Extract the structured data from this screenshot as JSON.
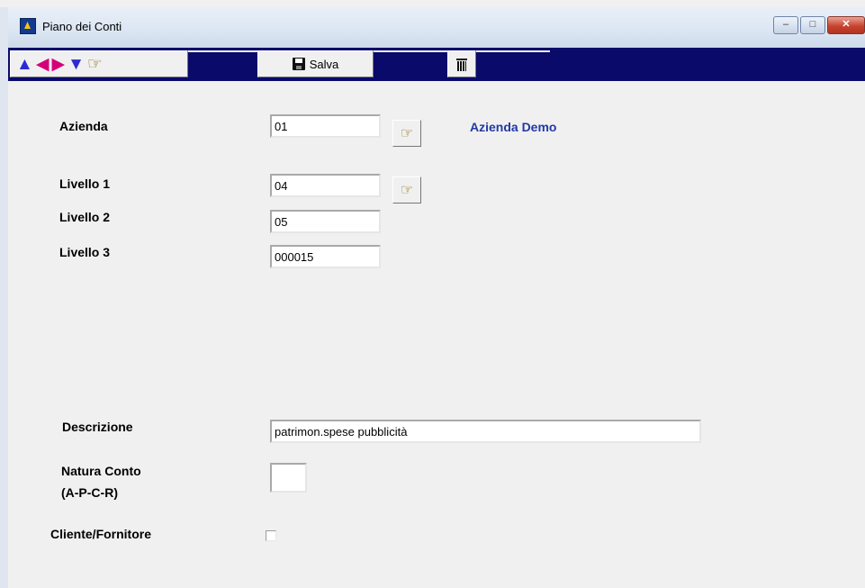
{
  "window": {
    "title": "Piano dei Conti",
    "controls": {
      "minimize": "–",
      "maximize": "□",
      "close": "✕"
    }
  },
  "toolbar": {
    "nav": [
      {
        "name": "first-record-icon",
        "glyph": "▲",
        "color": "#2b2bd6"
      },
      {
        "name": "previous-record-icon",
        "glyph": "◀",
        "color": "#d4007a"
      },
      {
        "name": "next-record-icon",
        "glyph": "▶",
        "color": "#d4007a"
      },
      {
        "name": "last-record-icon",
        "glyph": "▼",
        "color": "#2b2bd6"
      },
      {
        "name": "search-hand-icon",
        "glyph": "☞",
        "color": "#8a6d10"
      }
    ],
    "save_label": "Salva"
  },
  "form": {
    "azienda": {
      "label": "Azienda",
      "value": "01",
      "description": "Azienda Demo"
    },
    "livello1": {
      "label": "Livello 1",
      "value": "04"
    },
    "livello2": {
      "label": "Livello 2",
      "value": "05"
    },
    "livello3": {
      "label": "Livello 3",
      "value": "000015"
    },
    "descrizione": {
      "label": "Descrizione",
      "value": "patrimon.spese pubblicità"
    },
    "natura": {
      "label_line1": "Natura Conto",
      "label_line2": "(A-P-C-R)",
      "value": ""
    },
    "cliente_fornitore": {
      "label": "Cliente/Fornitore",
      "checked": false
    }
  },
  "colors": {
    "toolbar_bg": "#0a0a6b",
    "company_text": "#2239a6",
    "background": "#f0f0f0"
  }
}
